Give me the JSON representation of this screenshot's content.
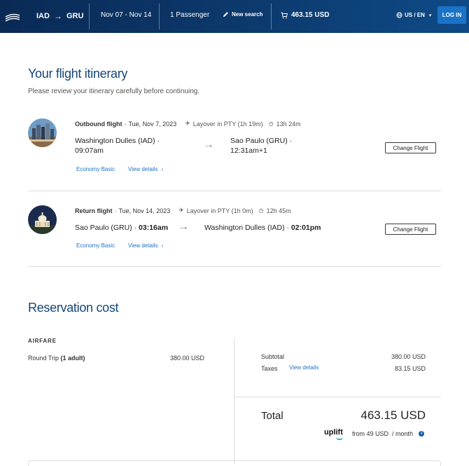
{
  "header": {
    "origin": "IAD",
    "destination": "GRU",
    "dates": "Nov 07 - Nov 14",
    "passengers": "1 Passenger",
    "new_search": "New search",
    "cart_total": "463.15 USD",
    "language": "US / EN",
    "login": "LOG IN"
  },
  "itinerary": {
    "title": "Your flight itinerary",
    "subtitle": "Please review your itinerary carefully before continuing.",
    "outbound": {
      "label": "Outbound flight",
      "date": "Tue, Nov 7, 2023",
      "layover": "Layover in PTY (1h 19m)",
      "duration": "13h 24m",
      "from_city": "Washington Dulles (IAD) ·",
      "from_time": "09:07am",
      "to_city": "Sao Paulo (GRU) ·",
      "to_time": "12:31am+1",
      "fare_class": "Economy Basic",
      "details": "View details",
      "change": "Change Flight"
    },
    "return": {
      "label": "Return flight",
      "date": "Tue, Nov 14, 2023",
      "layover": "Layover in PTY (1h 0m)",
      "duration": "12h 45m",
      "from_city": "Sao Paulo (GRU) ·",
      "from_time": "03:16am",
      "to_city": "Washington Dulles (IAD) ·",
      "to_time": "02:01pm",
      "fare_class": "Economy Basic",
      "details": "View details",
      "change": "Change Flight"
    }
  },
  "cost": {
    "title": "Reservation cost",
    "airfare_label": "AIRFARE",
    "round_trip": "Round Trip",
    "adults": "(1 adult)",
    "airfare_value": "380.00 USD",
    "subtotal_label": "Subtotal",
    "subtotal_value": "380.00 USD",
    "taxes_label": "Taxes",
    "taxes_details": "View details",
    "taxes_value": "83.15 USD",
    "total_label": "Total",
    "total_value": "463.15 USD",
    "uplift_brand": "uplift",
    "monthly_text": "from 49 USD  / month"
  },
  "icons": {
    "logo": "airline-logo-icon",
    "route_arrow": "arrow-right-icon",
    "new_search": "pencil-icon",
    "cart": "cart-icon",
    "globe": "globe-icon",
    "layover": "plane-icon",
    "duration": "clock-icon",
    "info": "info-icon"
  },
  "colors": {
    "header_bg": "#0c3a6e",
    "title": "#15457a",
    "link": "#1a73c8",
    "login_bg": "#1a73c8",
    "uplift_accent": "#2fb9c8"
  }
}
